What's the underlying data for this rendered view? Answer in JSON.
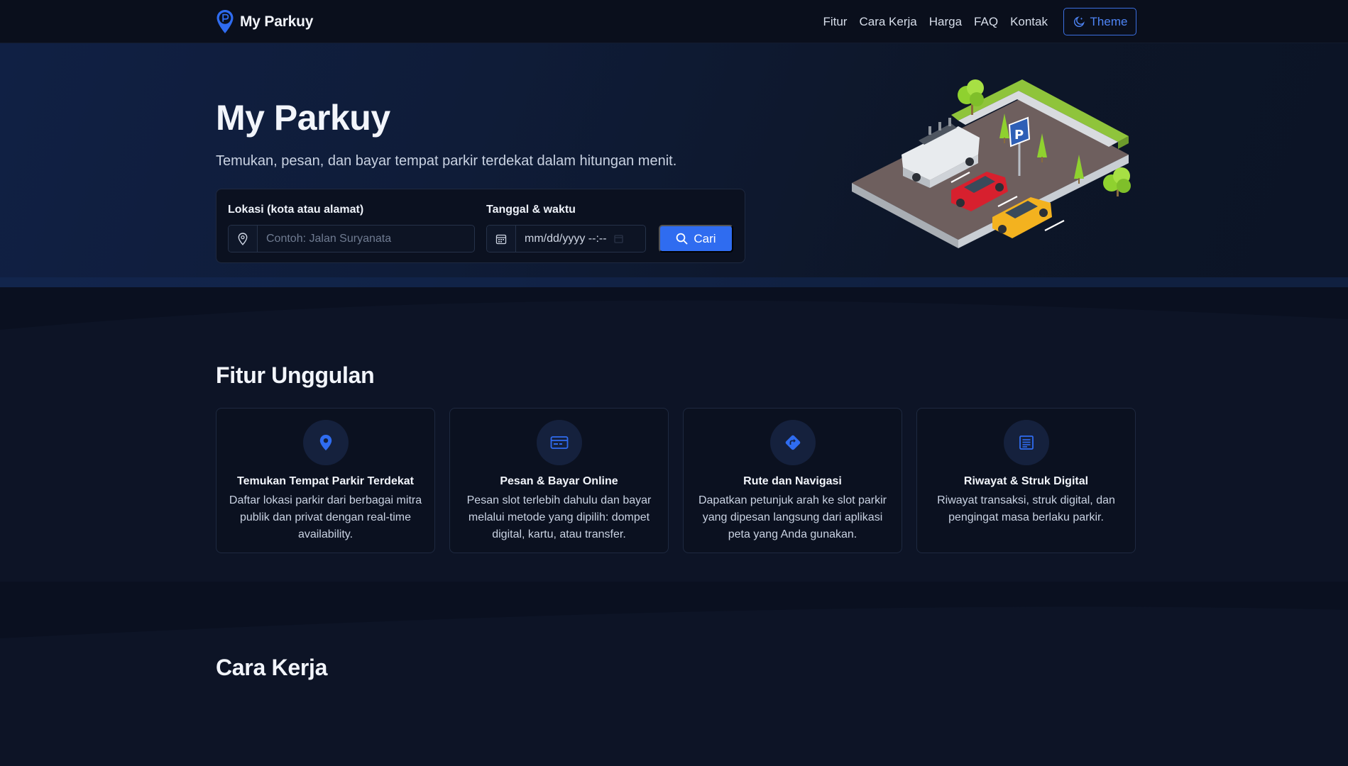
{
  "navbar": {
    "brand": "My Parkuy",
    "links": [
      "Fitur",
      "Cara Kerja",
      "Harga",
      "FAQ",
      "Kontak"
    ],
    "theme_label": "Theme"
  },
  "hero": {
    "title": "My Parkuy",
    "subtitle": "Temukan, pesan, dan bayar tempat parkir terdekat dalam hitungan menit.",
    "search": {
      "location_label": "Lokasi (kota atau alamat)",
      "location_placeholder": "Contoh: Jalan Suryanata",
      "datetime_label": "Tanggal & waktu",
      "datetime_value": "mm/dd/yyyy --:--",
      "button_label": "Cari"
    }
  },
  "features": {
    "title": "Fitur Unggulan",
    "items": [
      {
        "icon": "map-pin-icon",
        "title": "Temukan Tempat Parkir Terdekat",
        "desc": "Daftar lokasi parkir dari berbagai mitra publik dan privat dengan real-time availability."
      },
      {
        "icon": "card-icon",
        "title": "Pesan & Bayar Online",
        "desc": "Pesan slot terlebih dahulu dan bayar melalui metode yang dipilih: dompet digital, kartu, atau transfer."
      },
      {
        "icon": "direction-icon",
        "title": "Rute dan Navigasi",
        "desc": "Dapatkan petunjuk arah ke slot parkir yang dipesan langsung dari aplikasi peta yang Anda gunakan."
      },
      {
        "icon": "receipt-icon",
        "title": "Riwayat & Struk Digital",
        "desc": "Riwayat transaksi, struk digital, dan pengingat masa berlaku parkir."
      }
    ]
  },
  "how_it_works": {
    "title": "Cara Kerja"
  },
  "colors": {
    "accent": "#2f6cf0",
    "background": "#0d1426",
    "card": "#0b1120"
  }
}
